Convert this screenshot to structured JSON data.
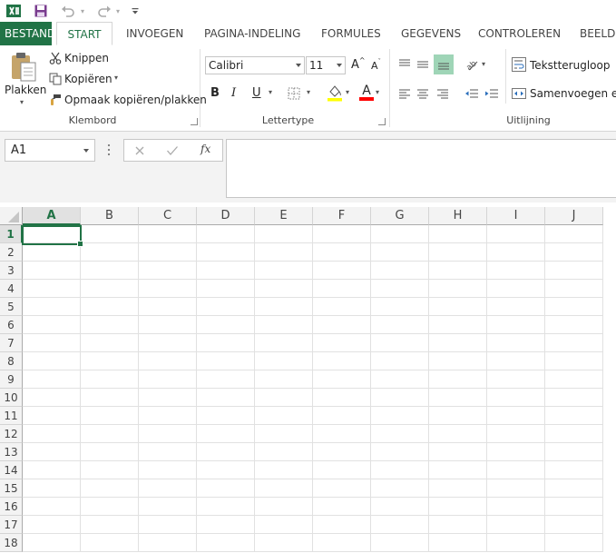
{
  "title_bar": {
    "app_icon": "excel-logo-icon",
    "quick_access": [
      "save-icon",
      "undo-icon",
      "redo-icon",
      "customize-icon"
    ]
  },
  "tabs": [
    {
      "label": "BESTAND"
    },
    {
      "label": "START"
    },
    {
      "label": "INVOEGEN"
    },
    {
      "label": "PAGINA-INDELING"
    },
    {
      "label": "FORMULES"
    },
    {
      "label": "GEGEVENS"
    },
    {
      "label": "CONTROLEREN"
    },
    {
      "label": "BEELD"
    }
  ],
  "ribbon": {
    "clipboard": {
      "paste_label": "Plakken",
      "cut_label": "Knippen",
      "copy_label": "Kopiëren",
      "format_painter_label": "Opmaak kopiëren/plakken",
      "group_label": "Klembord"
    },
    "font": {
      "font_name": "Calibri",
      "font_size": "11",
      "bold": "B",
      "italic": "I",
      "underline": "U",
      "font_color_letter": "A",
      "grow_letter": "A",
      "shrink_letter": "A",
      "group_label": "Lettertype"
    },
    "alignment": {
      "wrap_text_label": "Tekstterugloop",
      "merge_label": "Samenvoegen en",
      "group_label": "Uitlijning"
    }
  },
  "formula_bar": {
    "name_box": "A1",
    "fx": "fx",
    "formula_value": ""
  },
  "grid": {
    "columns": [
      "A",
      "B",
      "C",
      "D",
      "E",
      "F",
      "G",
      "H",
      "I",
      "J"
    ],
    "rows": [
      "1",
      "2",
      "3",
      "4",
      "5",
      "6",
      "7",
      "8",
      "9",
      "10",
      "11",
      "12",
      "13",
      "14",
      "15",
      "16",
      "17",
      "18"
    ],
    "selected_cell": "A1"
  },
  "colors": {
    "accent": "#217346",
    "highlight_yellow": "#ffff00",
    "font_red": "#ff0000"
  }
}
